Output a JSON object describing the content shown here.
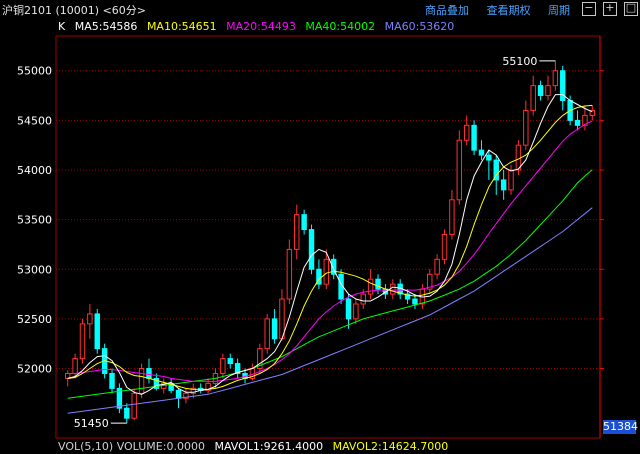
{
  "header": {
    "title": "沪铜2101 (10001) <60分>",
    "links": [
      "商品叠加",
      "查看期权",
      "周期"
    ],
    "icons": [
      "minus-box-icon",
      "plus-box-icon",
      "box-icon"
    ]
  },
  "legend": [
    {
      "label": "K",
      "color": "#ffffff"
    },
    {
      "label": "MA5:54586",
      "color": "#ffffff"
    },
    {
      "label": "MA10:54651",
      "color": "#ffff00"
    },
    {
      "label": "MA20:54493",
      "color": "#ff00ff"
    },
    {
      "label": "MA40:54002",
      "color": "#00ff00"
    },
    {
      "label": "MA60:53620",
      "color": "#8080ff"
    }
  ],
  "bottom": {
    "vol": "VOL(5,10) VOLUME:0.0000",
    "mavol1": "MAVOL1:9261.4000",
    "mavol2": "MAVOL2:14624.7000"
  },
  "price_box": "51384",
  "chart_data": {
    "type": "candlestick",
    "ylim": [
      51300,
      55350
    ],
    "yticks": [
      52000,
      52500,
      53000,
      53500,
      54000,
      54500,
      55000
    ],
    "annotations": [
      {
        "text": "55100",
        "value": 55100,
        "index": 66
      },
      {
        "text": "51450",
        "value": 51450,
        "index": 8
      }
    ],
    "colors": {
      "up": "#ff3030",
      "down": "#00ffff",
      "grid": "#a00000",
      "ma5": "#ffffff",
      "ma10": "#ffff00",
      "ma20": "#ff00ff",
      "ma40": "#00ff00",
      "ma60": "#8080ff"
    },
    "candles": [
      [
        51900,
        51950,
        51820,
        51980
      ],
      [
        51950,
        52100,
        51900,
        52150
      ],
      [
        52100,
        52450,
        52050,
        52500
      ],
      [
        52450,
        52550,
        52300,
        52650
      ],
      [
        52550,
        52200,
        52150,
        52600
      ],
      [
        52200,
        51950,
        51900,
        52250
      ],
      [
        51950,
        51800,
        51750,
        52000
      ],
      [
        51800,
        51600,
        51550,
        51850
      ],
      [
        51600,
        51500,
        51450,
        51650
      ],
      [
        51500,
        51750,
        51480,
        51800
      ],
      [
        51750,
        52000,
        51700,
        52050
      ],
      [
        52000,
        51900,
        51850,
        52100
      ],
      [
        51900,
        51800,
        51780,
        51950
      ],
      [
        51800,
        51850,
        51750,
        51900
      ],
      [
        51850,
        51780,
        51750,
        51900
      ],
      [
        51780,
        51700,
        51600,
        51800
      ],
      [
        51700,
        51750,
        51650,
        51800
      ],
      [
        51750,
        51800,
        51700,
        51850
      ],
      [
        51800,
        51780,
        51750,
        51850
      ],
      [
        51780,
        51850,
        51750,
        51900
      ],
      [
        51850,
        51950,
        51800,
        52000
      ],
      [
        51950,
        52100,
        51900,
        52150
      ],
      [
        52100,
        52050,
        52000,
        52150
      ],
      [
        52050,
        51950,
        51900,
        52100
      ],
      [
        51950,
        51900,
        51850,
        52000
      ],
      [
        51900,
        52000,
        51880,
        52050
      ],
      [
        52000,
        52200,
        51950,
        52250
      ],
      [
        52200,
        52500,
        52150,
        52550
      ],
      [
        52500,
        52300,
        52250,
        52600
      ],
      [
        52300,
        52700,
        52280,
        52800
      ],
      [
        52700,
        53200,
        52650,
        53300
      ],
      [
        53200,
        53550,
        53100,
        53650
      ],
      [
        53550,
        53400,
        53350,
        53600
      ],
      [
        53400,
        53000,
        52950,
        53450
      ],
      [
        53000,
        52850,
        52800,
        53100
      ],
      [
        52850,
        53100,
        52800,
        53200
      ],
      [
        53100,
        52950,
        52900,
        53150
      ],
      [
        52950,
        52700,
        52650,
        53000
      ],
      [
        52700,
        52500,
        52400,
        52750
      ],
      [
        52500,
        52650,
        52450,
        52700
      ],
      [
        52650,
        52750,
        52600,
        52800
      ],
      [
        52750,
        52900,
        52700,
        53000
      ],
      [
        52900,
        52800,
        52750,
        52950
      ],
      [
        52800,
        52750,
        52700,
        52850
      ],
      [
        52750,
        52850,
        52700,
        52900
      ],
      [
        52850,
        52750,
        52700,
        52900
      ],
      [
        52750,
        52700,
        52650,
        52800
      ],
      [
        52700,
        52650,
        52600,
        52750
      ],
      [
        52650,
        52800,
        52600,
        52850
      ],
      [
        52800,
        52950,
        52750,
        53000
      ],
      [
        52950,
        53100,
        52900,
        53150
      ],
      [
        53100,
        53350,
        53050,
        53400
      ],
      [
        53350,
        53700,
        53300,
        53800
      ],
      [
        53700,
        54300,
        53650,
        54400
      ],
      [
        54300,
        54450,
        54250,
        54550
      ],
      [
        54450,
        54200,
        54150,
        54500
      ],
      [
        54200,
        54150,
        54100,
        54300
      ],
      [
        54150,
        54100,
        53900,
        54200
      ],
      [
        54100,
        53900,
        53750,
        54150
      ],
      [
        53900,
        53800,
        53700,
        54000
      ],
      [
        53800,
        54000,
        53750,
        54050
      ],
      [
        54000,
        54250,
        53950,
        54300
      ],
      [
        54250,
        54600,
        54200,
        54700
      ],
      [
        54600,
        54850,
        54550,
        54950
      ],
      [
        54850,
        54750,
        54700,
        54900
      ],
      [
        54750,
        54850,
        54700,
        54950
      ],
      [
        54850,
        55000,
        54800,
        55100
      ],
      [
        55000,
        54700,
        54600,
        55050
      ],
      [
        54700,
        54500,
        54450,
        54750
      ],
      [
        54500,
        54450,
        54400,
        54600
      ],
      [
        54450,
        54550,
        54400,
        54650
      ],
      [
        54550,
        54600,
        54500,
        54650
      ]
    ],
    "ma5": [
      51900,
      51920,
      51980,
      52060,
      52120,
      52130,
      52080,
      51960,
      51810,
      51760,
      51740,
      51780,
      51830,
      51840,
      51860,
      51800,
      51760,
      51760,
      51780,
      51790,
      51820,
      51880,
      51930,
      51960,
      51980,
      52000,
      52050,
      52100,
      52170,
      52300,
      52520,
      52780,
      53020,
      53140,
      53200,
      53170,
      53000,
      52850,
      52750,
      52700,
      52680,
      52680,
      52720,
      52770,
      52820,
      52810,
      52780,
      52740,
      52720,
      52730,
      52780,
      52880,
      53050,
      53350,
      53700,
      53940,
      54080,
      54200,
      54150,
      54030,
      53990,
      54010,
      54100,
      54280,
      54470,
      54640,
      54760,
      54760,
      54700,
      54660,
      54620,
      54586
    ],
    "ma10": [
      51900,
      51910,
      51950,
      52000,
      52050,
      52080,
      52060,
      52020,
      51960,
      51930,
      51920,
      51900,
      51880,
      51860,
      51840,
      51820,
      51800,
      51790,
      51790,
      51790,
      51800,
      51820,
      51850,
      51880,
      51900,
      51920,
      51950,
      51990,
      52050,
      52150,
      52280,
      52450,
      52630,
      52780,
      52900,
      52960,
      52980,
      52970,
      52950,
      52930,
      52900,
      52860,
      52830,
      52800,
      52780,
      52760,
      52740,
      52730,
      52740,
      52760,
      52790,
      52840,
      52920,
      53050,
      53230,
      53450,
      53650,
      53830,
      53950,
      54030,
      54080,
      54110,
      54150,
      54220,
      54300,
      54390,
      54480,
      54550,
      54600,
      54630,
      54645,
      54651
    ],
    "ma20": [
      51950,
      51950,
      51960,
      51970,
      51980,
      51990,
      51990,
      51980,
      51970,
      51960,
      51950,
      51940,
      51930,
      51920,
      51900,
      51890,
      51880,
      51870,
      51870,
      51870,
      51870,
      51880,
      51890,
      51900,
      51920,
      51940,
      51970,
      52000,
      52040,
      52090,
      52150,
      52230,
      52320,
      52410,
      52500,
      52570,
      52630,
      52680,
      52720,
      52750,
      52770,
      52780,
      52790,
      52790,
      52790,
      52790,
      52790,
      52790,
      52800,
      52820,
      52840,
      52880,
      52920,
      52980,
      53060,
      53150,
      53250,
      53360,
      53460,
      53560,
      53660,
      53750,
      53840,
      53930,
      54020,
      54110,
      54200,
      54290,
      54360,
      54410,
      54460,
      54493
    ],
    "ma40": [
      51700,
      51710,
      51720,
      51730,
      51740,
      51750,
      51760,
      51770,
      51780,
      51790,
      51800,
      51810,
      51820,
      51830,
      51840,
      51850,
      51860,
      51870,
      51880,
      51890,
      51900,
      51920,
      51940,
      51960,
      51980,
      52000,
      52030,
      52060,
      52090,
      52120,
      52160,
      52200,
      52240,
      52280,
      52320,
      52350,
      52380,
      52410,
      52440,
      52470,
      52500,
      52520,
      52540,
      52560,
      52580,
      52600,
      52620,
      52640,
      52660,
      52680,
      52710,
      52740,
      52770,
      52800,
      52840,
      52880,
      52930,
      52980,
      53030,
      53090,
      53150,
      53220,
      53290,
      53370,
      53450,
      53530,
      53610,
      53690,
      53780,
      53870,
      53940,
      54002
    ],
    "ma60": [
      51550,
      51560,
      51570,
      51580,
      51590,
      51600,
      51610,
      51620,
      51630,
      51640,
      51650,
      51660,
      51670,
      51680,
      51690,
      51700,
      51710,
      51720,
      51730,
      51740,
      51760,
      51780,
      51800,
      51820,
      51840,
      51860,
      51880,
      51900,
      51920,
      51940,
      51970,
      52000,
      52030,
      52060,
      52090,
      52120,
      52150,
      52180,
      52210,
      52240,
      52270,
      52300,
      52330,
      52360,
      52390,
      52420,
      52450,
      52480,
      52510,
      52540,
      52580,
      52620,
      52660,
      52700,
      52740,
      52780,
      52830,
      52880,
      52930,
      52980,
      53030,
      53080,
      53130,
      53180,
      53230,
      53280,
      53330,
      53380,
      53440,
      53500,
      53560,
      53620
    ]
  }
}
